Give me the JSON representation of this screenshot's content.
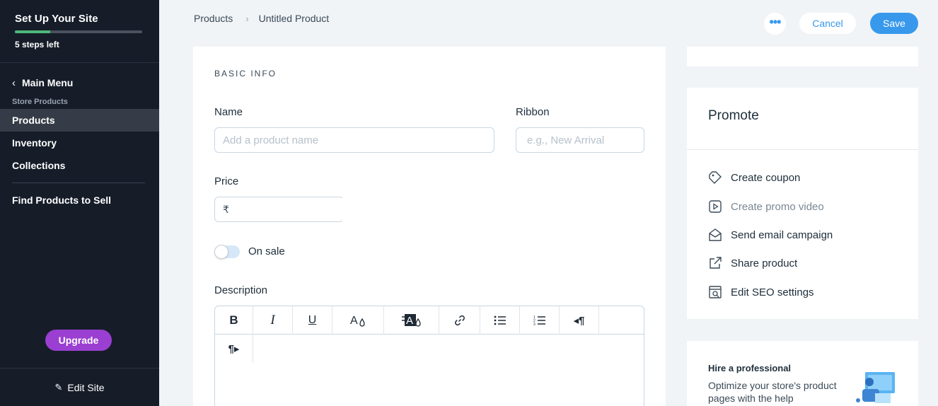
{
  "sidebar": {
    "setup_title": "Set Up Your Site",
    "progress": 0.28,
    "steps_left": "5 steps left",
    "main_menu": "Main Menu",
    "section_label": "Store Products",
    "items": [
      {
        "label": "Products"
      },
      {
        "label": "Inventory"
      },
      {
        "label": "Collections"
      }
    ],
    "find_products": "Find Products to Sell",
    "upgrade": "Upgrade",
    "edit_site": "Edit Site"
  },
  "header": {
    "breadcrumb": [
      "Products",
      "Untitled Product"
    ],
    "cancel": "Cancel",
    "save": "Save"
  },
  "form": {
    "section_title": "BASIC INFO",
    "name_label": "Name",
    "name_placeholder": "Add a product name",
    "ribbon_label": "Ribbon",
    "ribbon_placeholder": "e.g., New Arrival",
    "price_label": "Price",
    "currency": "₹",
    "on_sale_label": "On sale",
    "description_label": "Description"
  },
  "promote": {
    "title": "Promote",
    "items": [
      {
        "label": "Create coupon",
        "icon": "coupon-icon"
      },
      {
        "label": "Create promo video",
        "icon": "video-icon"
      },
      {
        "label": "Send email campaign",
        "icon": "email-icon"
      },
      {
        "label": "Share product",
        "icon": "share-icon"
      },
      {
        "label": "Edit SEO settings",
        "icon": "seo-icon"
      }
    ]
  },
  "hire": {
    "title": "Hire a professional",
    "text": "Optimize your store's product pages with the help"
  },
  "colors": {
    "sidebar_bg": "#161d29",
    "accent": "#3899ec",
    "upgrade": "#9a3fd1",
    "progress": "#4eb87a"
  }
}
